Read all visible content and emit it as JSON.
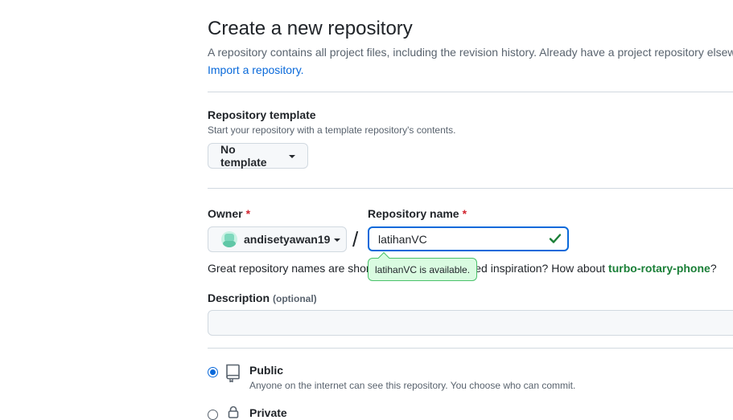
{
  "header": {
    "title": "Create a new repository",
    "intro": "A repository contains all project files, including the revision history. Already have a project repository elsewhere?",
    "import_link": "Import a repository."
  },
  "template": {
    "label": "Repository template",
    "hint": "Start your repository with a template repository's contents.",
    "selected": "No template"
  },
  "owner": {
    "label": "Owner",
    "required_mark": "*",
    "selected": "andisetyawan19"
  },
  "repo_name": {
    "label": "Repository name",
    "required_mark": "*",
    "separator": "/",
    "value": "latihanVC",
    "tooltip": "latihanVC is available."
  },
  "suggestion": {
    "prefix": "Great repository names are short and memorable. Need inspiration? How about ",
    "name": "turbo-rotary-phone",
    "suffix": "?"
  },
  "description": {
    "label": "Description",
    "optional": "(optional)",
    "value": ""
  },
  "visibility": {
    "selected": "public",
    "options": [
      {
        "title": "Public",
        "description": "Anyone on the internet can see this repository. You choose who can commit.",
        "icon": "repo-icon"
      },
      {
        "title": "Private",
        "description": "",
        "icon": "lock-icon"
      }
    ]
  },
  "colors": {
    "accent": "#0969da",
    "success": "#1a7f37",
    "success_bg": "#dafbe1",
    "required": "#d1242f"
  }
}
